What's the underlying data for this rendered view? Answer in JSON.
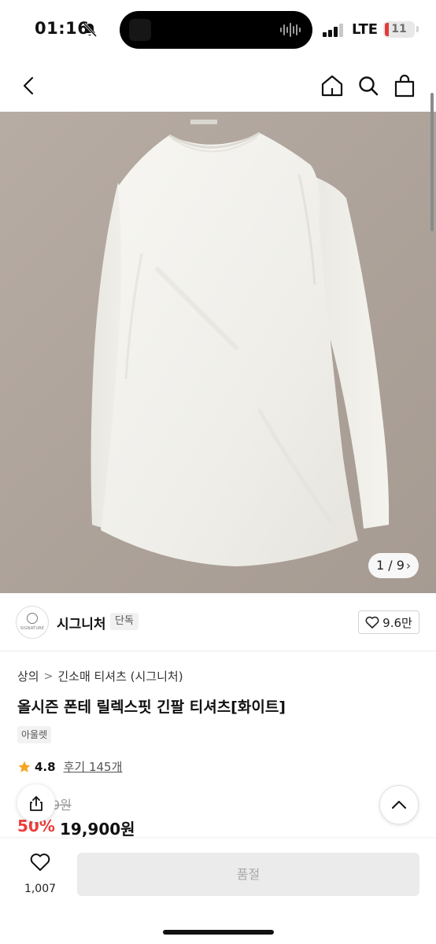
{
  "status_bar": {
    "time": "01:16",
    "network": "LTE",
    "battery_level": "11"
  },
  "header": {
    "icons": [
      "back-icon",
      "home-icon",
      "search-icon",
      "bag-icon"
    ]
  },
  "gallery": {
    "counter": "1 / 9"
  },
  "brand": {
    "logo_text": "SIGNATURE",
    "name": "시그니처",
    "badge": "단독",
    "likes": "9.6만"
  },
  "product": {
    "breadcrumb": [
      "상의",
      "긴소매 티셔츠 (시그니처)"
    ],
    "title": "올시즌 폰테 릴렉스핏 긴팔 티셔츠[화이트]",
    "tag": "아울렛",
    "rating": "4.8",
    "review_label": "후기 145개",
    "original_price": "9원",
    "discount": "50%",
    "sale_price": "19,900원"
  },
  "bottom_bar": {
    "wish_count": "1,007",
    "purchase_label": "품절"
  },
  "colors": {
    "discount": "#f03c3c",
    "star": "#f5a623",
    "image_bg": "#ada299"
  }
}
